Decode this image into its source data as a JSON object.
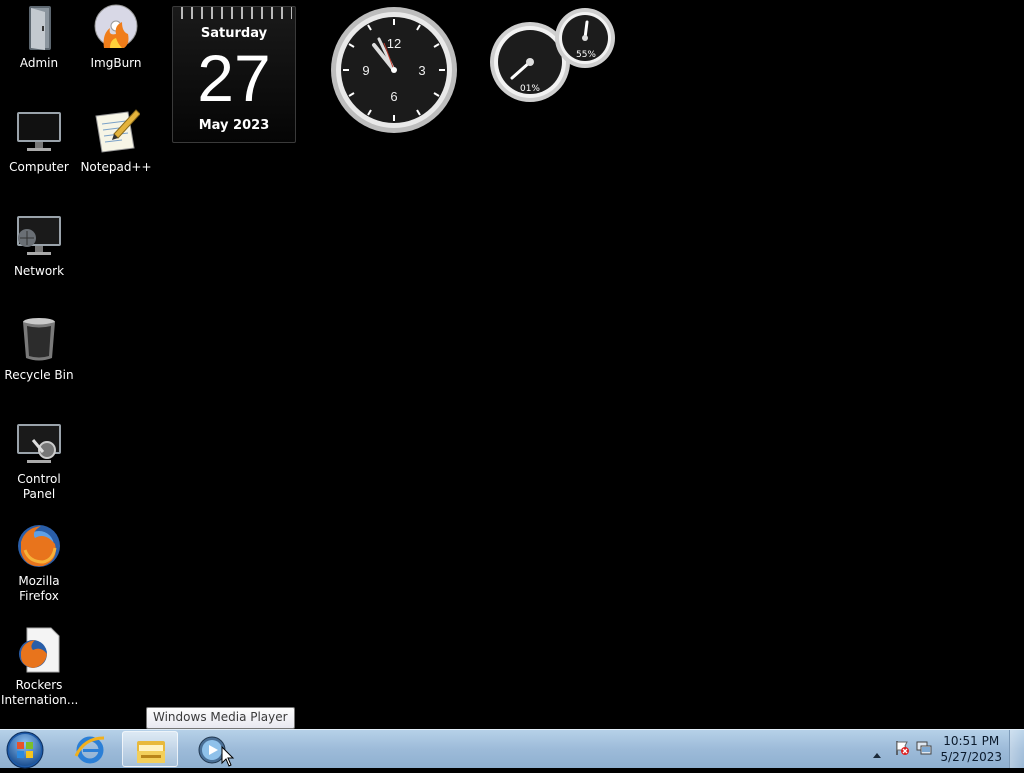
{
  "desktop": {
    "icons": [
      {
        "label": "Admin",
        "icon": "folder-icon"
      },
      {
        "label": "ImgBurn",
        "icon": "imgburn-icon"
      },
      {
        "label": "Computer",
        "icon": "computer-icon"
      },
      {
        "label": "Notepad++",
        "icon": "notepadpp-icon"
      },
      {
        "label": "Network",
        "icon": "network-icon"
      },
      {
        "label": "Recycle Bin",
        "icon": "recycle-bin-icon"
      },
      {
        "label": "Control Panel",
        "icon": "control-panel-icon"
      },
      {
        "label": "Mozilla Firefox",
        "icon": "firefox-icon"
      },
      {
        "label": "Rockers Internation...",
        "icon": "firefox-document-icon"
      }
    ]
  },
  "gadgets": {
    "calendar": {
      "weekday": "Saturday",
      "day": "27",
      "month_year": "May 2023"
    },
    "clock": {
      "numerals": [
        "12",
        "3",
        "6",
        "9"
      ]
    },
    "cpu_meter": {
      "cpu_label": "01%",
      "memory_label": "55%",
      "cpu": 0.01,
      "memory": 0.55
    }
  },
  "tooltip": {
    "text": "Windows Media Player"
  },
  "taskbar": {
    "pinned": [
      {
        "name": "Internet Explorer",
        "icon": "internet-explorer-icon"
      },
      {
        "name": "Windows Explorer",
        "icon": "windows-explorer-icon"
      },
      {
        "name": "Windows Media Player",
        "icon": "windows-media-player-icon"
      }
    ],
    "tray": {
      "time": "10:51 PM",
      "date": "5/27/2023"
    }
  },
  "colors": {
    "desktop_bg": "#000000",
    "taskbar": "#9dbbd9"
  }
}
